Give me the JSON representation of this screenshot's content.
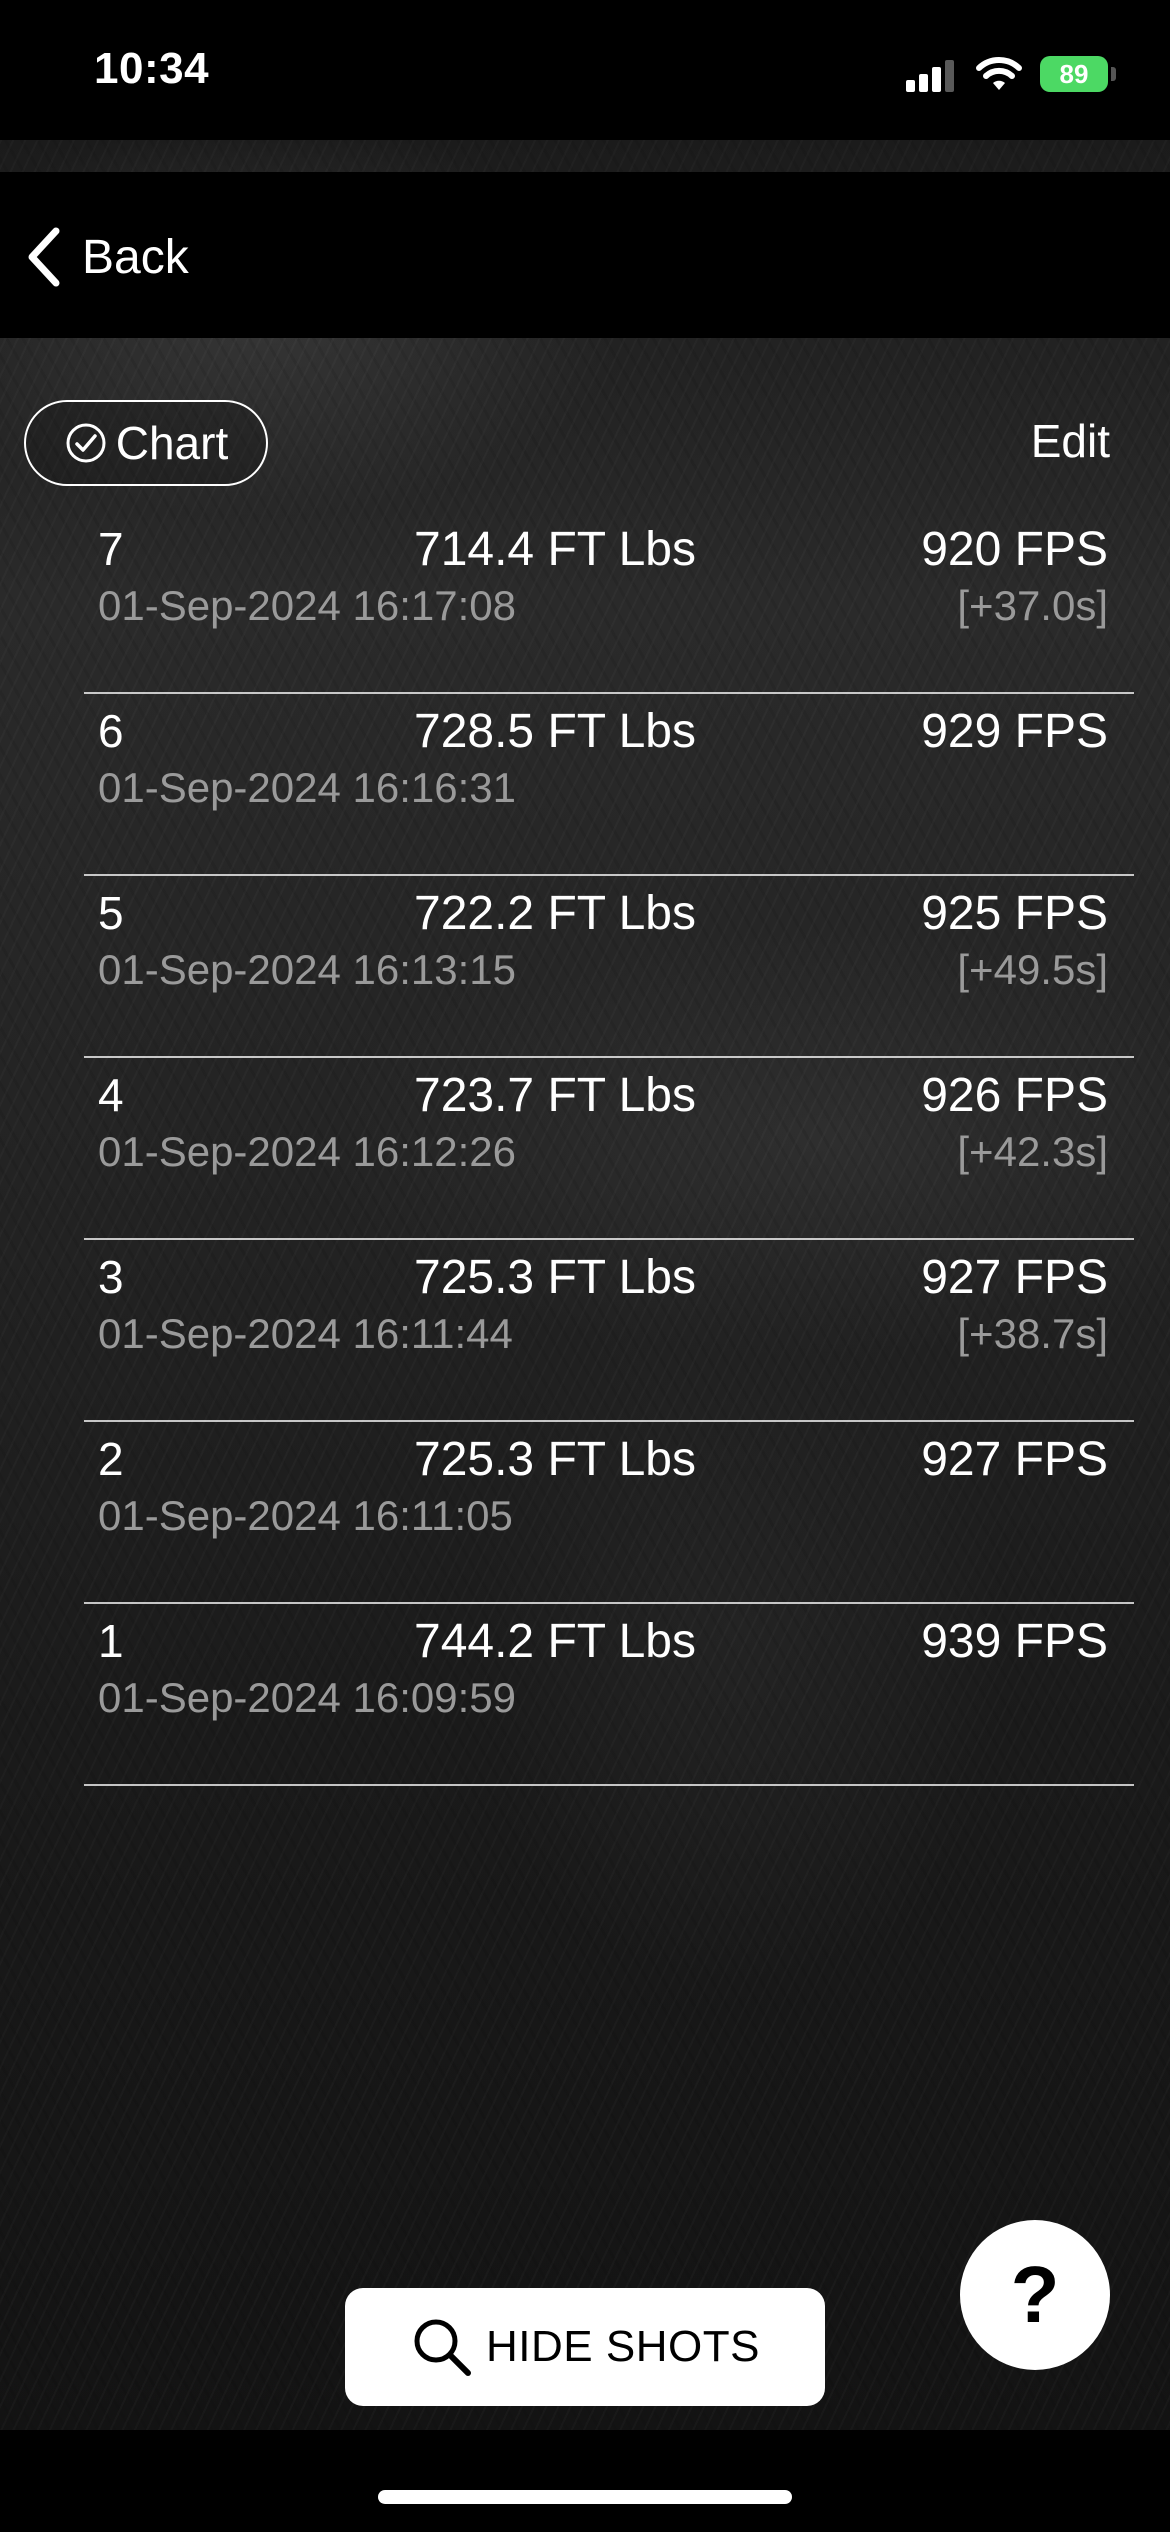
{
  "status_bar": {
    "time": "10:34",
    "battery": "89",
    "icons": [
      "signal-icon",
      "wifi-icon",
      "battery-icon"
    ]
  },
  "nav": {
    "back_label": "Back",
    "back_icon": "chevron-left-icon"
  },
  "toolbar": {
    "chart_label": "Chart",
    "chart_icon": "check-circle-icon",
    "edit_label": "Edit"
  },
  "shots": [
    {
      "number": "7",
      "energy": "714.4 FT Lbs",
      "fps": "920 FPS",
      "timestamp": "01-Sep-2024 16:17:08",
      "delta": "[+37.0s]"
    },
    {
      "number": "6",
      "energy": "728.5 FT Lbs",
      "fps": "929 FPS",
      "timestamp": "01-Sep-2024 16:16:31",
      "delta": ""
    },
    {
      "number": "5",
      "energy": "722.2 FT Lbs",
      "fps": "925 FPS",
      "timestamp": "01-Sep-2024 16:13:15",
      "delta": "[+49.5s]"
    },
    {
      "number": "4",
      "energy": "723.7 FT Lbs",
      "fps": "926 FPS",
      "timestamp": "01-Sep-2024 16:12:26",
      "delta": "[+42.3s]"
    },
    {
      "number": "3",
      "energy": "725.3 FT Lbs",
      "fps": "927 FPS",
      "timestamp": "01-Sep-2024 16:11:44",
      "delta": "[+38.7s]"
    },
    {
      "number": "2",
      "energy": "725.3 FT Lbs",
      "fps": "927 FPS",
      "timestamp": "01-Sep-2024 16:11:05",
      "delta": ""
    },
    {
      "number": "1",
      "energy": "744.2 FT Lbs",
      "fps": "939 FPS",
      "timestamp": "01-Sep-2024 16:09:59",
      "delta": ""
    }
  ],
  "bottom": {
    "hide_shots_label": "HIDE SHOTS",
    "hide_shots_icon": "search-icon",
    "help_label": "?"
  },
  "colors": {
    "background": "#000000",
    "text_primary": "#ffffff",
    "text_secondary": "#9a9a9a",
    "battery": "#4cd964",
    "button_bg": "#ffffff"
  }
}
